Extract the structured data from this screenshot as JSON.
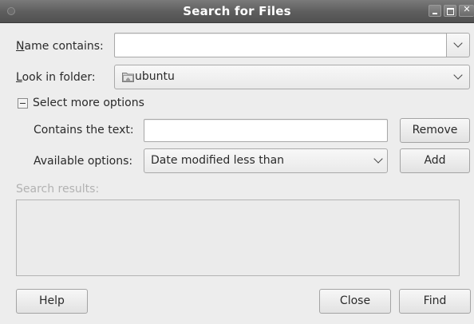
{
  "window": {
    "title": "Search for Files"
  },
  "name_field": {
    "label": "Name contains:",
    "value": ""
  },
  "folder_field": {
    "label": "Look in folder:",
    "value": "ubuntu"
  },
  "more_options": {
    "label": "Select more options"
  },
  "contains_text": {
    "label": "Contains the text:",
    "value": ""
  },
  "available_options": {
    "label": "Available options:",
    "selected": "Date modified less than"
  },
  "buttons": {
    "remove": "Remove",
    "add": "Add",
    "help": "Help",
    "close": "Close",
    "find": "Find"
  },
  "results": {
    "label": "Search results:"
  }
}
